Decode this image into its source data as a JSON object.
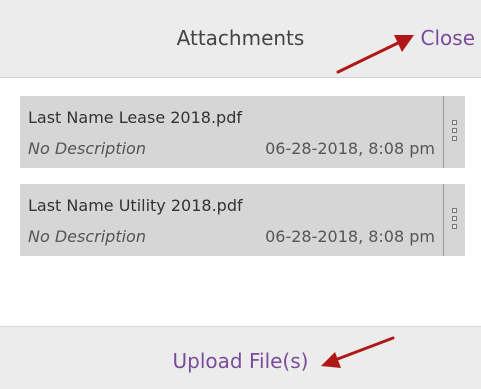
{
  "header": {
    "title": "Attachments",
    "close_label": "Close"
  },
  "files": [
    {
      "name": "Last Name Lease 2018.pdf",
      "description": "No Description",
      "date": "06-28-2018, 8:08 pm"
    },
    {
      "name": "Last Name Utility 2018.pdf",
      "description": "No Description",
      "date": "06-28-2018, 8:08 pm"
    }
  ],
  "footer": {
    "upload_label": "Upload File(s)"
  },
  "colors": {
    "link": "#7b4b9c",
    "annotation_arrow": "#b01818",
    "card_bg": "#d6d6d6",
    "bar_bg": "#ececec"
  },
  "icons": {
    "file_menu": "kebab-menu-icon",
    "annotation": "red-arrow-icon"
  }
}
